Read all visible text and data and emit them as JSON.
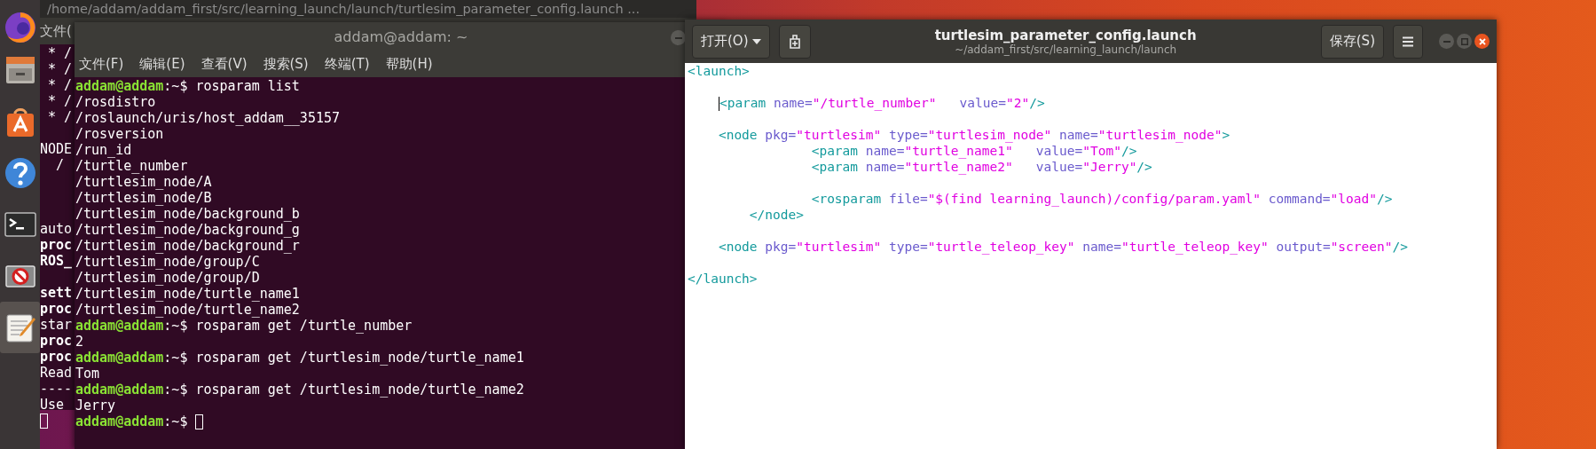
{
  "dock": {
    "items": [
      {
        "kind": "browser",
        "selected": false
      },
      {
        "kind": "files",
        "selected": false
      },
      {
        "kind": "software",
        "selected": false
      },
      {
        "kind": "help",
        "selected": false
      },
      {
        "kind": "terminal",
        "selected": false
      },
      {
        "kind": "blocked",
        "selected": false
      },
      {
        "kind": "editor",
        "selected": true
      }
    ]
  },
  "back_terminal": {
    "title": "/home/addam/addam_first/src/learning_launch/launch/turtlesim_parameter_config.launch ...",
    "menu": [
      "文件("
    ],
    "rows": [
      {
        "kind": "text",
        "text": " * /",
        "bold": false
      },
      {
        "kind": "text",
        "text": " * /",
        "bold": false
      },
      {
        "kind": "text",
        "text": " * /",
        "bold": false
      },
      {
        "kind": "text",
        "text": " * /",
        "bold": false
      },
      {
        "kind": "text",
        "text": " * /",
        "bold": false
      },
      {
        "kind": "blank"
      },
      {
        "kind": "text",
        "text": "NODE",
        "bold": false
      },
      {
        "kind": "text",
        "text": "  /",
        "bold": false
      },
      {
        "kind": "blank"
      },
      {
        "kind": "blank"
      },
      {
        "kind": "blank"
      },
      {
        "kind": "text",
        "text": "auto",
        "bold": false
      },
      {
        "kind": "text",
        "text": "proc",
        "bold": true
      },
      {
        "kind": "text",
        "text": "ROS_",
        "bold": true
      },
      {
        "kind": "blank"
      },
      {
        "kind": "text",
        "text": "sett",
        "bold": true
      },
      {
        "kind": "text",
        "text": "proc",
        "bold": true
      },
      {
        "kind": "text",
        "text": "star",
        "bold": false
      },
      {
        "kind": "text",
        "text": "proc",
        "bold": true
      },
      {
        "kind": "text",
        "text": "proc",
        "bold": true
      },
      {
        "kind": "text",
        "text": "Read",
        "bold": false
      },
      {
        "kind": "text",
        "text": "----",
        "bold": false
      },
      {
        "kind": "text",
        "text": "Use",
        "bold": false
      },
      {
        "kind": "cursor"
      }
    ]
  },
  "terminal": {
    "title": "addam@addam: ~",
    "menu": [
      "文件(F)",
      "编辑(E)",
      "查看(V)",
      "搜索(S)",
      "终端(T)",
      "帮助(H)"
    ],
    "lines": [
      {
        "kind": "prompt",
        "user": "addam@addam",
        "text": ":~$ rosparam list",
        "cursor": false
      },
      {
        "kind": "output",
        "text": "/rosdistro"
      },
      {
        "kind": "output",
        "text": "/roslaunch/uris/host_addam__35157"
      },
      {
        "kind": "output",
        "text": "/rosversion"
      },
      {
        "kind": "output",
        "text": "/run_id"
      },
      {
        "kind": "output",
        "text": "/turtle_number"
      },
      {
        "kind": "output",
        "text": "/turtlesim_node/A"
      },
      {
        "kind": "output",
        "text": "/turtlesim_node/B"
      },
      {
        "kind": "output",
        "text": "/turtlesim_node/background_b"
      },
      {
        "kind": "output",
        "text": "/turtlesim_node/background_g"
      },
      {
        "kind": "output",
        "text": "/turtlesim_node/background_r"
      },
      {
        "kind": "output",
        "text": "/turtlesim_node/group/C"
      },
      {
        "kind": "output",
        "text": "/turtlesim_node/group/D"
      },
      {
        "kind": "output",
        "text": "/turtlesim_node/turtle_name1"
      },
      {
        "kind": "output",
        "text": "/turtlesim_node/turtle_name2"
      },
      {
        "kind": "prompt",
        "user": "addam@addam",
        "text": ":~$ rosparam get /turtle_number",
        "cursor": false
      },
      {
        "kind": "output",
        "text": "2"
      },
      {
        "kind": "prompt",
        "user": "addam@addam",
        "text": ":~$ rosparam get /turtlesim_node/turtle_name1",
        "cursor": false
      },
      {
        "kind": "output",
        "text": "Tom"
      },
      {
        "kind": "prompt",
        "user": "addam@addam",
        "text": ":~$ rosparam get /turtlesim_node/turtle_name2",
        "cursor": false
      },
      {
        "kind": "output",
        "text": "Jerry"
      },
      {
        "kind": "prompt",
        "user": "addam@addam",
        "text": ":~$ ",
        "cursor": true
      }
    ]
  },
  "editor": {
    "open_button": "打开(O)",
    "title": "turtlesim_parameter_config.launch",
    "subtitle": "~/addam_first/src/learning_launch/launch",
    "save_button": "保存(S)",
    "lines": [
      {
        "kind": "code",
        "cursor": false,
        "tokens": [
          {
            "kind": "tag",
            "text": "<launch>"
          }
        ]
      },
      {
        "kind": "blank"
      },
      {
        "kind": "code",
        "cursor": true,
        "tokens": [
          {
            "kind": "tag",
            "text": "    <param"
          },
          {
            "kind": "attr",
            "text": " name="
          },
          {
            "kind": "string",
            "text": "\"/turtle_number\""
          },
          {
            "kind": "attr",
            "text": "   value="
          },
          {
            "kind": "string",
            "text": "\"2\""
          },
          {
            "kind": "tag",
            "text": "/>"
          }
        ]
      },
      {
        "kind": "blank"
      },
      {
        "kind": "code",
        "cursor": false,
        "tokens": [
          {
            "kind": "tag",
            "text": "    <node"
          },
          {
            "kind": "attr",
            "text": " pkg="
          },
          {
            "kind": "string",
            "text": "\"turtlesim\""
          },
          {
            "kind": "attr",
            "text": " type="
          },
          {
            "kind": "string",
            "text": "\"turtlesim_node\""
          },
          {
            "kind": "attr",
            "text": " name="
          },
          {
            "kind": "string",
            "text": "\"turtlesim_node\""
          },
          {
            "kind": "tag",
            "text": ">"
          }
        ]
      },
      {
        "kind": "code",
        "cursor": false,
        "tokens": [
          {
            "kind": "tag",
            "text": "                <param"
          },
          {
            "kind": "attr",
            "text": " name="
          },
          {
            "kind": "string",
            "text": "\"turtle_name1\""
          },
          {
            "kind": "attr",
            "text": "   value="
          },
          {
            "kind": "string",
            "text": "\"Tom\""
          },
          {
            "kind": "tag",
            "text": "/>"
          }
        ]
      },
      {
        "kind": "code",
        "cursor": false,
        "tokens": [
          {
            "kind": "tag",
            "text": "                <param"
          },
          {
            "kind": "attr",
            "text": " name="
          },
          {
            "kind": "string",
            "text": "\"turtle_name2\""
          },
          {
            "kind": "attr",
            "text": "   value="
          },
          {
            "kind": "string",
            "text": "\"Jerry\""
          },
          {
            "kind": "tag",
            "text": "/>"
          }
        ]
      },
      {
        "kind": "blank"
      },
      {
        "kind": "code",
        "cursor": false,
        "tokens": [
          {
            "kind": "tag",
            "text": "                <rosparam"
          },
          {
            "kind": "attr",
            "text": " file="
          },
          {
            "kind": "string",
            "text": "\"$(find learning_launch)/config/param.yaml\""
          },
          {
            "kind": "attr",
            "text": " command="
          },
          {
            "kind": "string",
            "text": "\"load\""
          },
          {
            "kind": "tag",
            "text": "/>"
          }
        ]
      },
      {
        "kind": "code",
        "cursor": false,
        "tokens": [
          {
            "kind": "tag",
            "text": "        </node>"
          }
        ]
      },
      {
        "kind": "blank"
      },
      {
        "kind": "code",
        "cursor": false,
        "tokens": [
          {
            "kind": "tag",
            "text": "    <node"
          },
          {
            "kind": "attr",
            "text": " pkg="
          },
          {
            "kind": "string",
            "text": "\"turtlesim\""
          },
          {
            "kind": "attr",
            "text": " type="
          },
          {
            "kind": "string",
            "text": "\"turtle_teleop_key\""
          },
          {
            "kind": "attr",
            "text": " name="
          },
          {
            "kind": "string",
            "text": "\"turtle_teleop_key\""
          },
          {
            "kind": "attr",
            "text": " output="
          },
          {
            "kind": "string",
            "text": "\"screen\""
          },
          {
            "kind": "tag",
            "text": "/>"
          }
        ]
      },
      {
        "kind": "blank"
      },
      {
        "kind": "code",
        "cursor": false,
        "tokens": [
          {
            "kind": "tag",
            "text": "</launch>"
          }
        ]
      }
    ]
  }
}
